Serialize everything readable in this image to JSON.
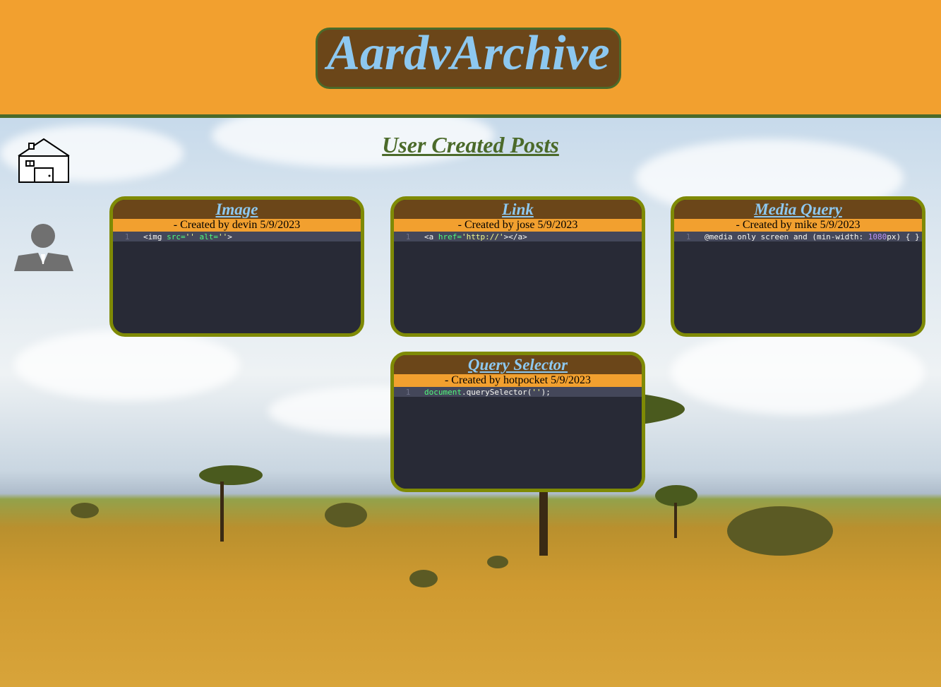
{
  "app": {
    "title": "AardvArchive",
    "colors": {
      "accent": "#f2a02f",
      "brand_brown": "#6b4619",
      "brand_green": "#4b6a2a",
      "title_blue": "#8dc8f0",
      "card_border": "#7f8a05",
      "editor_bg": "#282a36"
    }
  },
  "nav": {
    "home_icon": "home-icon",
    "profile_icon": "user-profile-icon"
  },
  "main": {
    "section_title": "User Created Posts"
  },
  "posts": [
    {
      "title": "Image",
      "meta": "- Created by devin 5/9/2023",
      "line_number": "1",
      "code": [
        {
          "t": "<img ",
          "c": ""
        },
        {
          "t": "src=",
          "c": "tk-attr"
        },
        {
          "t": "''",
          "c": "tk-str"
        },
        {
          "t": " alt=",
          "c": "tk-attr"
        },
        {
          "t": "''",
          "c": "tk-str"
        },
        {
          "t": ">",
          "c": ""
        }
      ]
    },
    {
      "title": "Link",
      "meta": "- Created by jose 5/9/2023",
      "line_number": "1",
      "code": [
        {
          "t": "<a ",
          "c": ""
        },
        {
          "t": "href=",
          "c": "tk-attr"
        },
        {
          "t": "'http://'",
          "c": "tk-str"
        },
        {
          "t": "></a>",
          "c": ""
        }
      ]
    },
    {
      "title": "Media Query",
      "meta": "- Created by mike 5/9/2023",
      "line_number": "1",
      "code": [
        {
          "t": "@media only screen and (min-width: ",
          "c": ""
        },
        {
          "t": "1080",
          "c": "tk-num"
        },
        {
          "t": "px) { }",
          "c": ""
        }
      ]
    },
    {
      "title": "Query Selector",
      "meta": "- Created by hotpocket 5/9/2023",
      "line_number": "1",
      "code": [
        {
          "t": "document",
          "c": "tk-fn"
        },
        {
          "t": ".querySelector(",
          "c": ""
        },
        {
          "t": "''",
          "c": "tk-str"
        },
        {
          "t": ");",
          "c": ""
        }
      ]
    }
  ]
}
